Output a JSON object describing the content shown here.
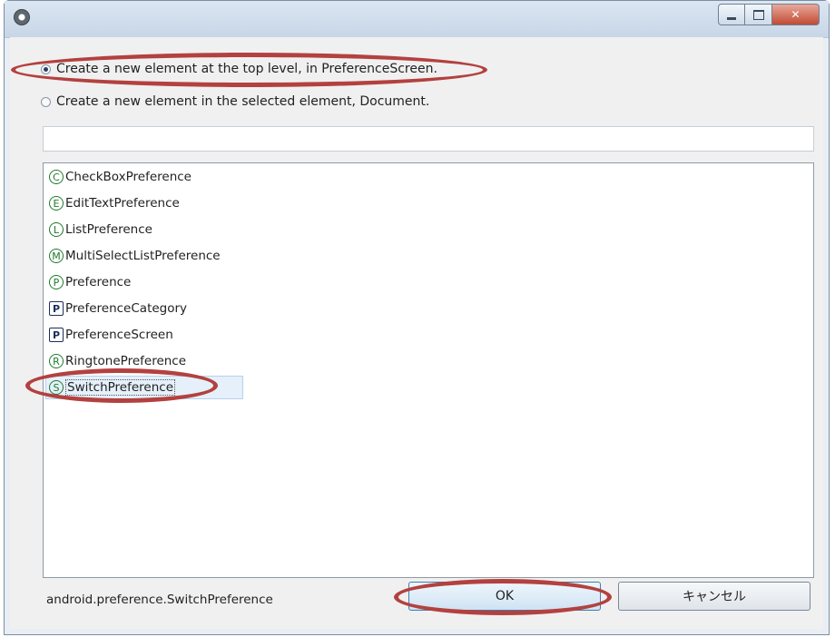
{
  "window": {
    "app_icon": "eclipse-gear-icon",
    "title": "",
    "controls": {
      "minimize": "minimize-icon",
      "maximize": "maximize-icon",
      "close": "close-icon"
    }
  },
  "options": {
    "top_level": {
      "label": "Create a new element at the top level, in PreferenceScreen.",
      "checked": true
    },
    "in_selected": {
      "label": "Create a new element in the selected element, Document.",
      "checked": false
    }
  },
  "filter": {
    "value": "",
    "placeholder": ""
  },
  "elements": [
    {
      "badge": "C",
      "badge_style": "circle",
      "label": "CheckBoxPreference"
    },
    {
      "badge": "E",
      "badge_style": "circle",
      "label": "EditTextPreference"
    },
    {
      "badge": "L",
      "badge_style": "circle",
      "label": "ListPreference"
    },
    {
      "badge": "M",
      "badge_style": "circle",
      "label": "MultiSelectListPreference"
    },
    {
      "badge": "P",
      "badge_style": "circle",
      "label": "Preference"
    },
    {
      "badge": "P",
      "badge_style": "square",
      "label": "PreferenceCategory"
    },
    {
      "badge": "P",
      "badge_style": "square",
      "label": "PreferenceScreen"
    },
    {
      "badge": "R",
      "badge_style": "circle",
      "label": "RingtonePreference"
    },
    {
      "badge": "S",
      "badge_style": "circle",
      "label": "SwitchPreference",
      "selected": true
    }
  ],
  "status": {
    "text": "android.preference.SwitchPreference"
  },
  "buttons": {
    "ok": "OK",
    "cancel": "キャンセル"
  },
  "colors": {
    "annotation": "#b3413f",
    "badge_green": "#1f7a2c",
    "badge_navy": "#1c2f5b"
  }
}
